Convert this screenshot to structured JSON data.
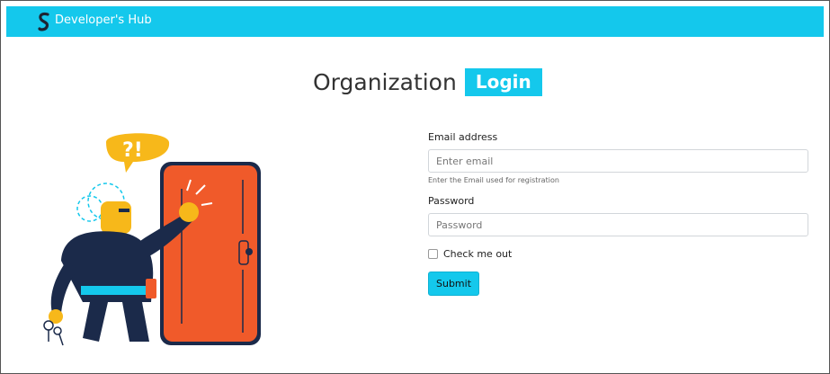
{
  "navbar": {
    "brand_name": "Developer's Hub",
    "brand_icon": "s-logo-icon",
    "color": "#14c8ec"
  },
  "heading": {
    "text": "Organization",
    "badge": "Login"
  },
  "form": {
    "email_label": "Email address",
    "email_placeholder": "Enter email",
    "email_help": "Enter the Email used for registration",
    "password_label": "Password",
    "password_placeholder": "Password",
    "remember_label": "Check me out",
    "remember_checked": false,
    "submit_label": "Submit"
  },
  "illustration": {
    "speech_bubble": "?!"
  },
  "colors": {
    "accent": "#14c8ec",
    "door": "#f05a2a",
    "figure": "#1b2a4a",
    "skin": "#f7b81a"
  }
}
